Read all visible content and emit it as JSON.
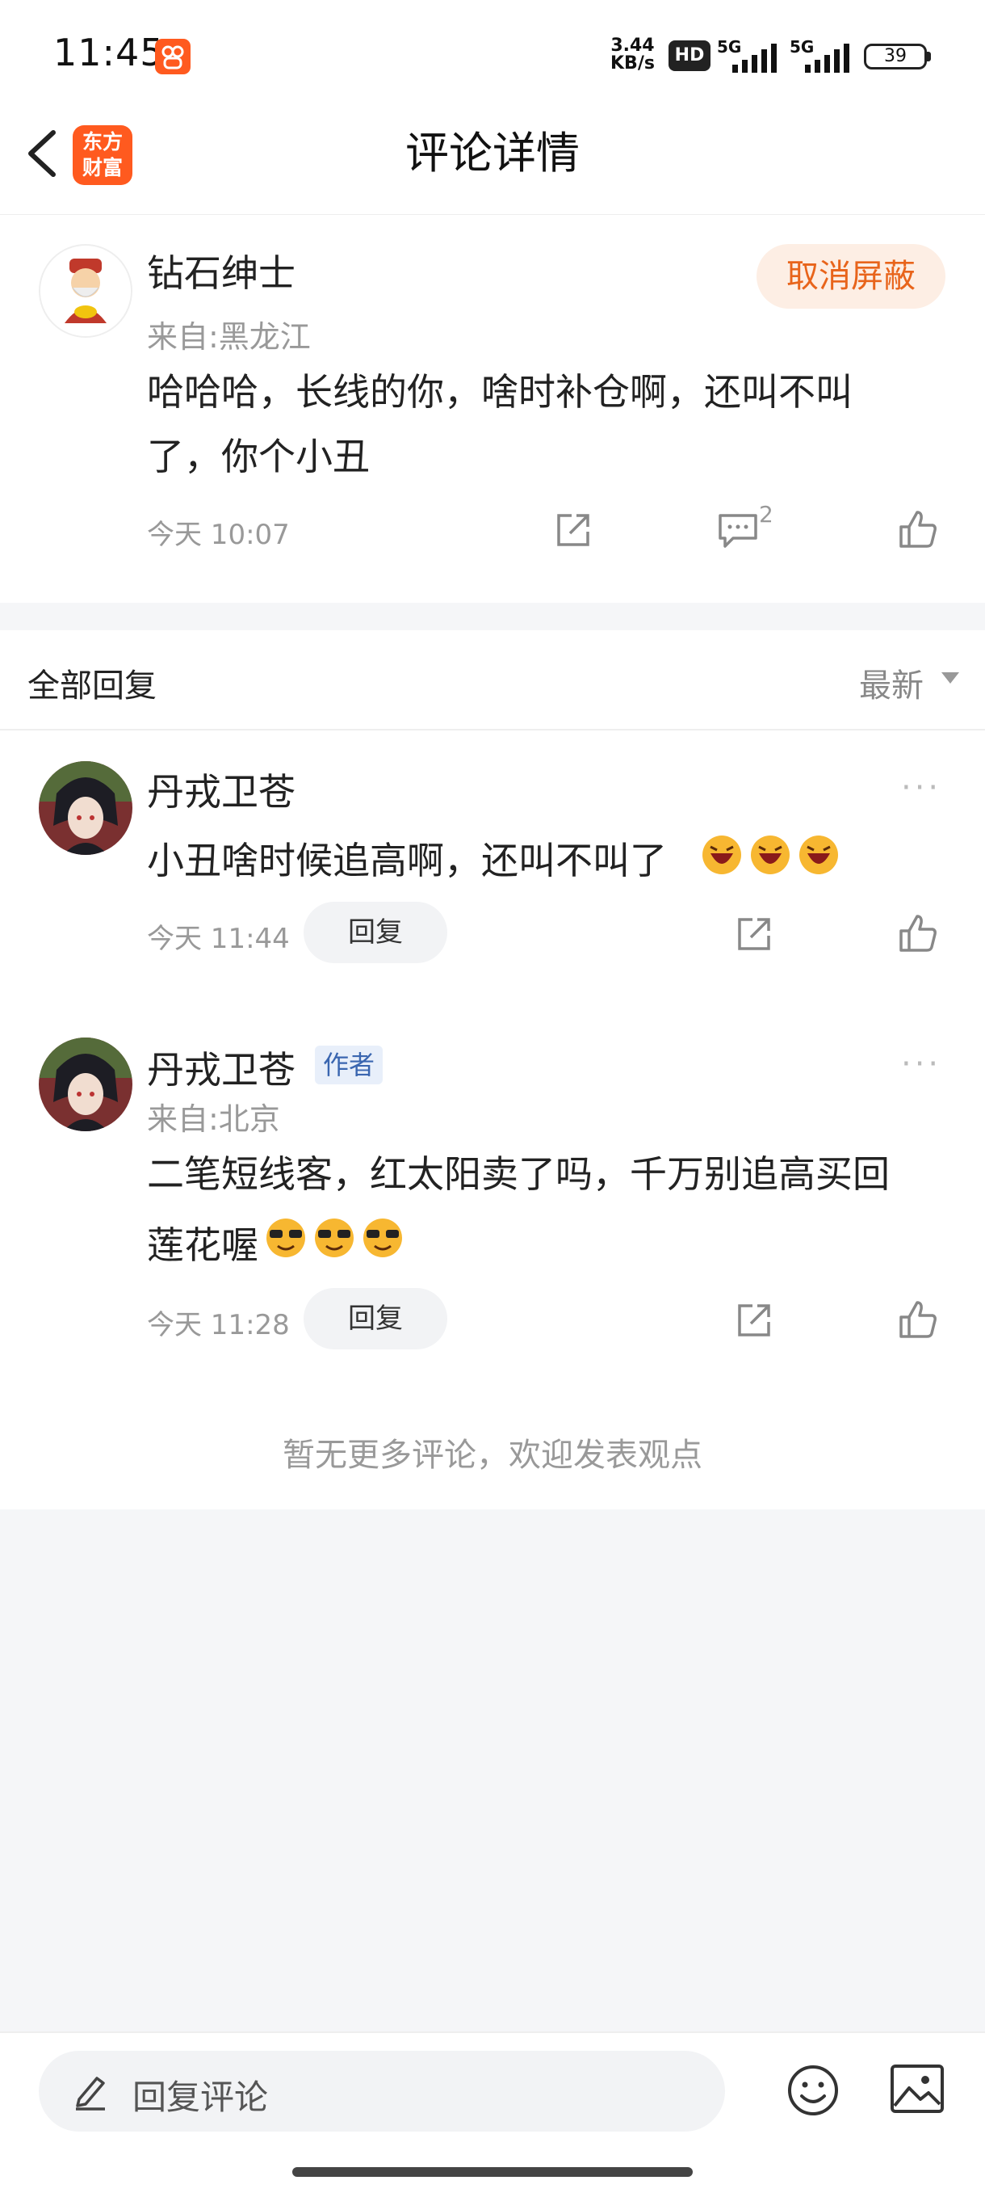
{
  "status_bar": {
    "time": "11:45",
    "net_speed_value": "3.44",
    "net_speed_unit": "KB/s",
    "hd_label": "HD",
    "signal1_label": "5G",
    "signal2_label": "5G",
    "battery": "39"
  },
  "nav": {
    "logo_line1": "东方",
    "logo_line2": "财富",
    "title": "评论详情"
  },
  "main_comment": {
    "username": "钻石绅士",
    "location": "来自:黑龙江",
    "text_line1": "哈哈哈，长线的你，啥时补仓啊，还叫不叫",
    "text_line2": "了，你个小丑",
    "time": "今天 10:07",
    "reply_count": "2",
    "unblock_label": "取消屏蔽"
  },
  "replies_header": {
    "title": "全部回复",
    "sort_label": "最新"
  },
  "replies": [
    {
      "username": "丹戎卫苍",
      "text": "小丑啥时候追高啊，还叫不叫了",
      "time": "今天 11:44",
      "reply_label": "回复",
      "more": "···"
    },
    {
      "username": "丹戎卫苍",
      "author_tag": "作者",
      "location": "来自:北京",
      "text_line1": "二笔短线客，红太阳卖了吗，千万别追高买回",
      "text_line2": "莲花喔",
      "time": "今天 11:28",
      "reply_label": "回复",
      "more": "···"
    }
  ],
  "no_more_text": "暂无更多评论，欢迎发表观点",
  "bottom_bar": {
    "placeholder": "回复评论"
  },
  "colors": {
    "accent_orange": "#e8641b",
    "brand_orange": "#ff5a1f",
    "author_tag_blue": "#3a66b0",
    "page_bg": "#f5f6f8"
  }
}
